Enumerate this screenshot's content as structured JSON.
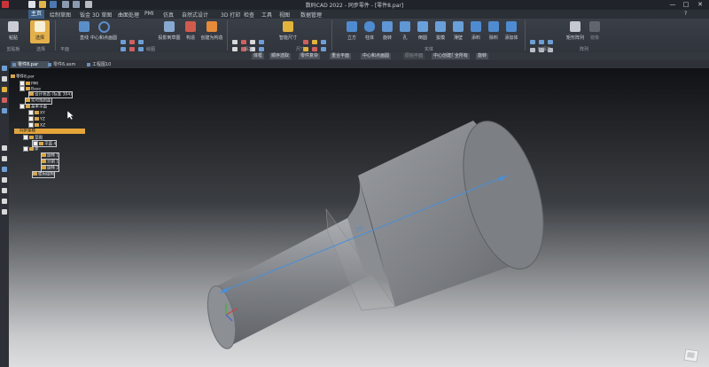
{
  "window": {
    "title": "数码CAD 2022 - 同步零件 - [零件8.par]",
    "minimize": "—",
    "restore": "□",
    "close": "✕"
  },
  "menu": [
    "主页",
    "绘制草图",
    "钣金 3D 草图",
    "曲面处理",
    "PMI",
    "仿真",
    "自然式设计",
    "3D 打印",
    "检查",
    "工具",
    "视图",
    "数据管理"
  ],
  "ribbon": {
    "groups": [
      {
        "label": "剪贴板"
      },
      {
        "label": "选择"
      },
      {
        "label": "平面"
      },
      {
        "label": "绘图"
      },
      {
        "label": "相关"
      },
      {
        "label": "尺寸"
      },
      {
        "label": "实体"
      },
      {
        "label": "面相关"
      },
      {
        "label": "阵列"
      }
    ],
    "buttons": [
      {
        "label": "粘贴"
      },
      {
        "label": "选择"
      },
      {
        "label": "直线"
      },
      {
        "label": "中心和点画圆"
      },
      {
        "label": "投影到草图"
      },
      {
        "label": "构造"
      },
      {
        "label": "创建为构造"
      },
      {
        "label": "智能尺寸"
      },
      {
        "label": "立方"
      },
      {
        "label": "柱体"
      },
      {
        "label": "旋转"
      },
      {
        "label": "孔"
      },
      {
        "label": "倒圆"
      },
      {
        "label": "拔模"
      },
      {
        "label": "薄壁"
      },
      {
        "label": "添料"
      },
      {
        "label": "除料"
      },
      {
        "label": "添加体"
      },
      {
        "label": "矩形阵列"
      },
      {
        "label": "镜像"
      }
    ]
  },
  "select_bar": [
    "体框",
    "顺序选取",
    "零件复杂",
    "重合平面",
    "中心和点画圆",
    "原始平面",
    "中心创建范面",
    "全所有",
    "旋转"
  ],
  "doc_tabs": [
    "零件8.par",
    "零件6.asm",
    "工程图10"
  ],
  "tree": [
    {
      "label": "零件8.par",
      "level": 0
    },
    {
      "label": "PMI",
      "level": 1
    },
    {
      "label": "Base",
      "level": 1
    },
    {
      "label": "设计状态 (标准 304)",
      "level": 2
    },
    {
      "label": "实时规则面",
      "level": 1
    },
    {
      "label": "基本平面",
      "level": 1
    },
    {
      "label": "XY",
      "level": 2
    },
    {
      "label": "YZ",
      "level": 2
    },
    {
      "label": "XZ",
      "level": 2
    },
    {
      "label": "同步建模",
      "level": 0
    },
    {
      "label": "草图",
      "level": 1
    },
    {
      "label": "平面 4",
      "level": 2
    },
    {
      "label": "体",
      "level": 1
    },
    {
      "label": "旋转 1",
      "level": 2
    },
    {
      "label": "分割 1",
      "level": 2
    },
    {
      "label": "旋转 2",
      "level": 2
    },
    {
      "label": "使用结构",
      "level": 1
    }
  ],
  "dimension_label": "20",
  "colors": {
    "accent": "#3d5f86",
    "highlight": "#e5a43a",
    "model": "#8d9096",
    "dim": "#4a8fd8"
  }
}
